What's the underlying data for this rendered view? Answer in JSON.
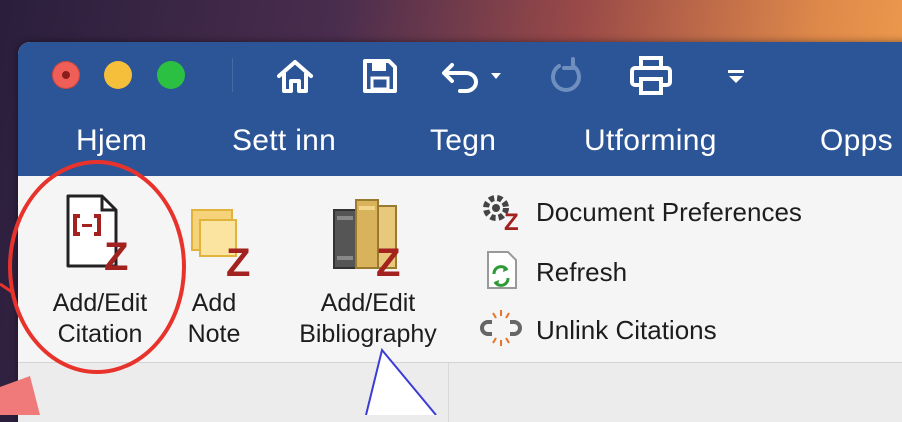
{
  "window": {
    "traffic_lights": [
      "close-button",
      "minimize-button",
      "zoom-button"
    ]
  },
  "quick_access": {
    "icons": [
      "home-icon",
      "save-icon",
      "undo-icon",
      "dropdown-caret-icon",
      "redo-icon",
      "print-icon",
      "customize-toolbar-icon"
    ]
  },
  "tabs": [
    "Hjem",
    "Sett inn",
    "Tegn",
    "Utforming",
    "Opps"
  ],
  "ribbon": {
    "add_edit_citation": "Add/Edit Citation",
    "add_note": "Add Note",
    "add_edit_bibliography": "Add/Edit Bibliography",
    "document_preferences": "Document Preferences",
    "refresh": "Refresh",
    "unlink_citations": "Unlink Citations"
  },
  "colors": {
    "title_bar": "#2b5597",
    "zotero_red": "#a3211f",
    "highlight_circle": "#e8332c",
    "annotation_arrow": "#3b3bd6"
  }
}
